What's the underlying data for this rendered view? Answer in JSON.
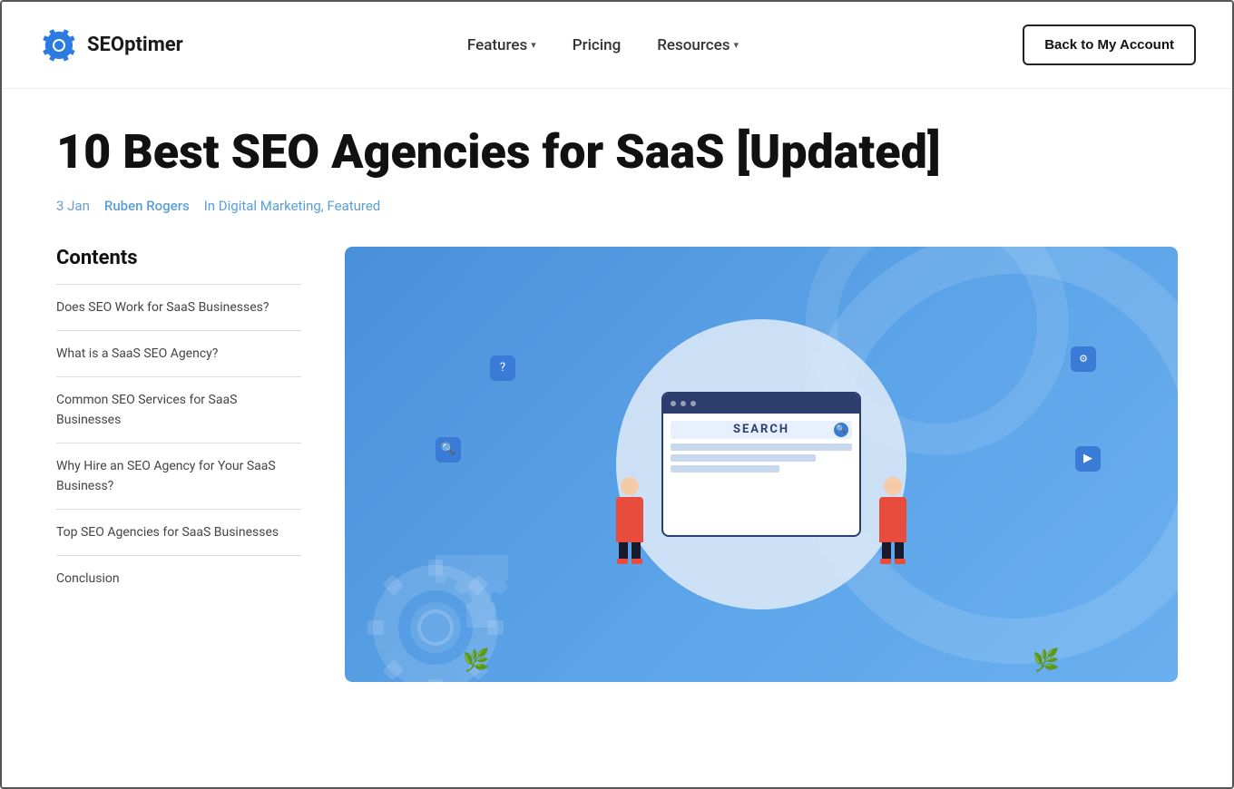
{
  "brand": {
    "name": "SEOptimer",
    "logo_alt": "SEOptimer logo"
  },
  "nav": {
    "links": [
      {
        "label": "Features",
        "has_dropdown": true
      },
      {
        "label": "Pricing",
        "has_dropdown": false
      },
      {
        "label": "Resources",
        "has_dropdown": true
      }
    ],
    "cta_label": "Back to My Account"
  },
  "article": {
    "title": "10 Best SEO Agencies for SaaS [Updated]",
    "meta": {
      "date": "3 Jan",
      "author": "Ruben Rogers",
      "categories": "In Digital Marketing, Featured"
    }
  },
  "toc": {
    "heading": "Contents",
    "items": [
      {
        "label": "Does SEO Work for SaaS Businesses?"
      },
      {
        "label": "What is a SaaS SEO Agency?"
      },
      {
        "label": "Common SEO Services for SaaS Businesses"
      },
      {
        "label": "Why Hire an SEO Agency for Your SaaS Business?"
      },
      {
        "label": "Top SEO Agencies for SaaS Businesses"
      },
      {
        "label": "Conclusion"
      }
    ]
  },
  "hero": {
    "search_text": "SEARCH"
  }
}
